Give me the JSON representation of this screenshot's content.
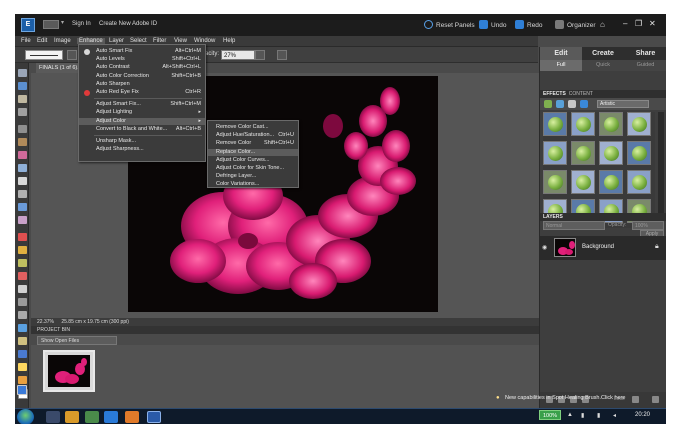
{
  "title_bar": {
    "logo_text": "E",
    "sign_in": "Sign In",
    "create_id": "Create New Adobe ID",
    "reset_panels": "Reset Panels",
    "undo": "Undo",
    "redo": "Redo",
    "organizer": "Organizer",
    "minimize": "–",
    "restore": "❐",
    "close": "✕"
  },
  "menubar": [
    "File",
    "Edit",
    "Image",
    "Enhance",
    "Layer",
    "Select",
    "Filter",
    "View",
    "Window",
    "Help"
  ],
  "options_bar": {
    "opacity_label": "acity:",
    "opacity_value": "27%"
  },
  "document": {
    "tab": "FINALS (1 of 6).jp...",
    "status": "22.37%",
    "dimensions": "25.85 cm x 19.75 cm (300 ppi)"
  },
  "enhance_menu": [
    {
      "label": "Auto Smart Fix",
      "shortcut": "Alt+Ctrl+M"
    },
    {
      "label": "Auto Levels",
      "shortcut": "Shift+Ctrl+L"
    },
    {
      "label": "Auto Contrast",
      "shortcut": "Alt+Shift+Ctrl+L"
    },
    {
      "label": "Auto Color Correction",
      "shortcut": "Shift+Ctrl+B"
    },
    {
      "label": "Auto Sharpen",
      "shortcut": ""
    },
    {
      "label": "Auto Red Eye Fix",
      "shortcut": "Ctrl+R"
    },
    {
      "label": "Adjust Smart Fix...",
      "shortcut": "Shift+Ctrl+M"
    },
    {
      "label": "Adjust Lighting",
      "shortcut": ""
    },
    {
      "label": "Adjust Color",
      "shortcut": ""
    },
    {
      "label": "Convert to Black and White...",
      "shortcut": "Alt+Ctrl+B"
    },
    {
      "label": "Unsharp Mask...",
      "shortcut": ""
    },
    {
      "label": "Adjust Sharpness...",
      "shortcut": ""
    }
  ],
  "adjust_color_menu": [
    {
      "label": "Remove Color Cast...",
      "shortcut": ""
    },
    {
      "label": "Adjust Hue/Saturation...",
      "shortcut": "Ctrl+U"
    },
    {
      "label": "Remove Color",
      "shortcut": "Shift+Ctrl+U"
    },
    {
      "label": "Replace Color...",
      "shortcut": ""
    },
    {
      "label": "Adjust Color Curves...",
      "shortcut": ""
    },
    {
      "label": "Adjust Color for Skin Tone...",
      "shortcut": ""
    },
    {
      "label": "Defringe Layer...",
      "shortcut": ""
    },
    {
      "label": "Color Variations...",
      "shortcut": ""
    }
  ],
  "right_panel": {
    "tabs": {
      "edit": "Edit",
      "create": "Create",
      "share": "Share"
    },
    "subtabs": {
      "full": "Full",
      "quick": "Quick",
      "guided": "Guided"
    },
    "effects_head": "EFFECTS",
    "content_head": "CONTENT",
    "effects_dropdown": "Artistic",
    "apply_label": "Apply",
    "layers_head": "LAYERS",
    "blend_mode": "Normal",
    "opacity_label": "Opacity:",
    "opacity_value": "100%",
    "layer_name": "Background",
    "lock_label": "Lock"
  },
  "project_bin": {
    "head": "PROJECT BIN",
    "select": "Show Open Files"
  },
  "taskbar": {
    "notification": "New capabilities in Spot Healing Brush.Click here",
    "zoom": "100%",
    "time": "20:20"
  },
  "colors": {
    "flower_pink": "#e0207a",
    "accent_blue": "#1c5fa8",
    "menu_bg": "#3b3b3b"
  }
}
